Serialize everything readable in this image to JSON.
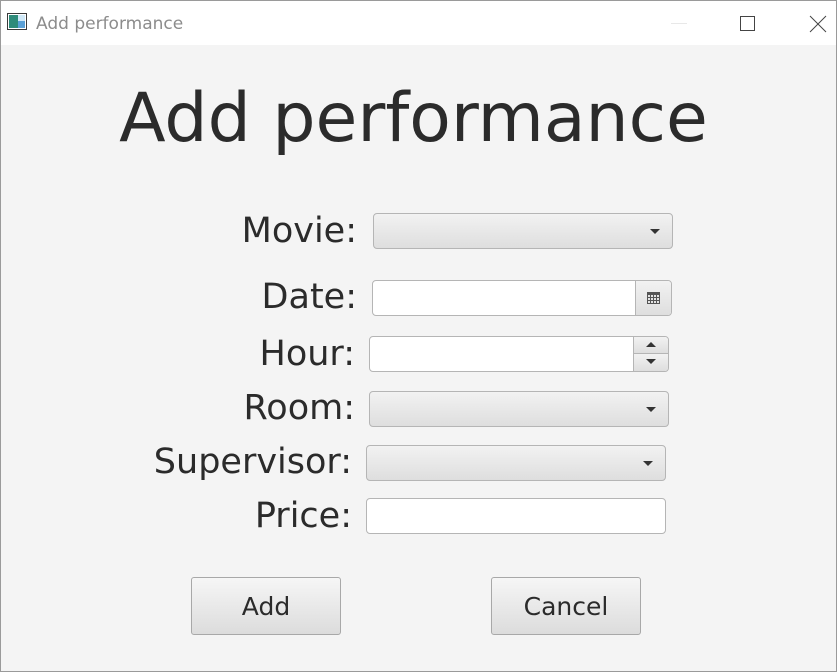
{
  "window": {
    "title": "Add performance",
    "icon": "app-window-icon",
    "controls": {
      "minimize_icon": "minimize-icon",
      "maximize_icon": "maximize-icon",
      "close_icon": "close-icon"
    }
  },
  "heading": "Add performance",
  "form": {
    "movie": {
      "label": "Movie:",
      "value": ""
    },
    "date": {
      "label": "Date:",
      "value": "",
      "icon": "calendar-icon"
    },
    "hour": {
      "label": "Hour:",
      "value": ""
    },
    "room": {
      "label": "Room:",
      "value": ""
    },
    "supervisor": {
      "label": "Supervisor:",
      "value": ""
    },
    "price": {
      "label": "Price:",
      "value": ""
    }
  },
  "buttons": {
    "add": "Add",
    "cancel": "Cancel"
  },
  "colors": {
    "background": "#f4f4f4",
    "titlebar": "#ffffff",
    "text": "#2b2b2b",
    "title_text": "#8c8c8c",
    "border": "#b5b5b5"
  }
}
